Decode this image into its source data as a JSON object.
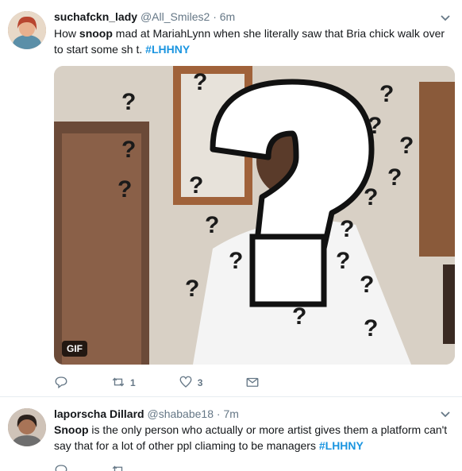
{
  "tweets": [
    {
      "fullname": "suchafckn_lady",
      "screen_name": "@All_Smiles2",
      "separator": "·",
      "time": "6m",
      "text_a": "How ",
      "text_bold": "snoop",
      "text_b": " mad at MariahLynn when she literally saw that Bria chick walk over to start some sh t. ",
      "hashtag": "#LHHNY",
      "media_badge": "GIF",
      "reply_count": "",
      "retweet_count": "1",
      "like_count": "3",
      "icons": [
        "reply-icon",
        "retweet-icon",
        "like-icon",
        "message-icon",
        "chevron-down-icon"
      ]
    },
    {
      "fullname": "laporscha Dillard",
      "screen_name": "@shababe18",
      "separator": "·",
      "time": "7m",
      "text_bold": "Snoop",
      "text_b": " is the only person who actually or more artist gives them a platform can't say that for a lot of other ppl cliaming to be managers ",
      "hashtag": "#LHHNY"
    }
  ],
  "colors": {
    "link": "#1b95e0",
    "secondary": "#657786",
    "border": "#e6ecf0"
  }
}
